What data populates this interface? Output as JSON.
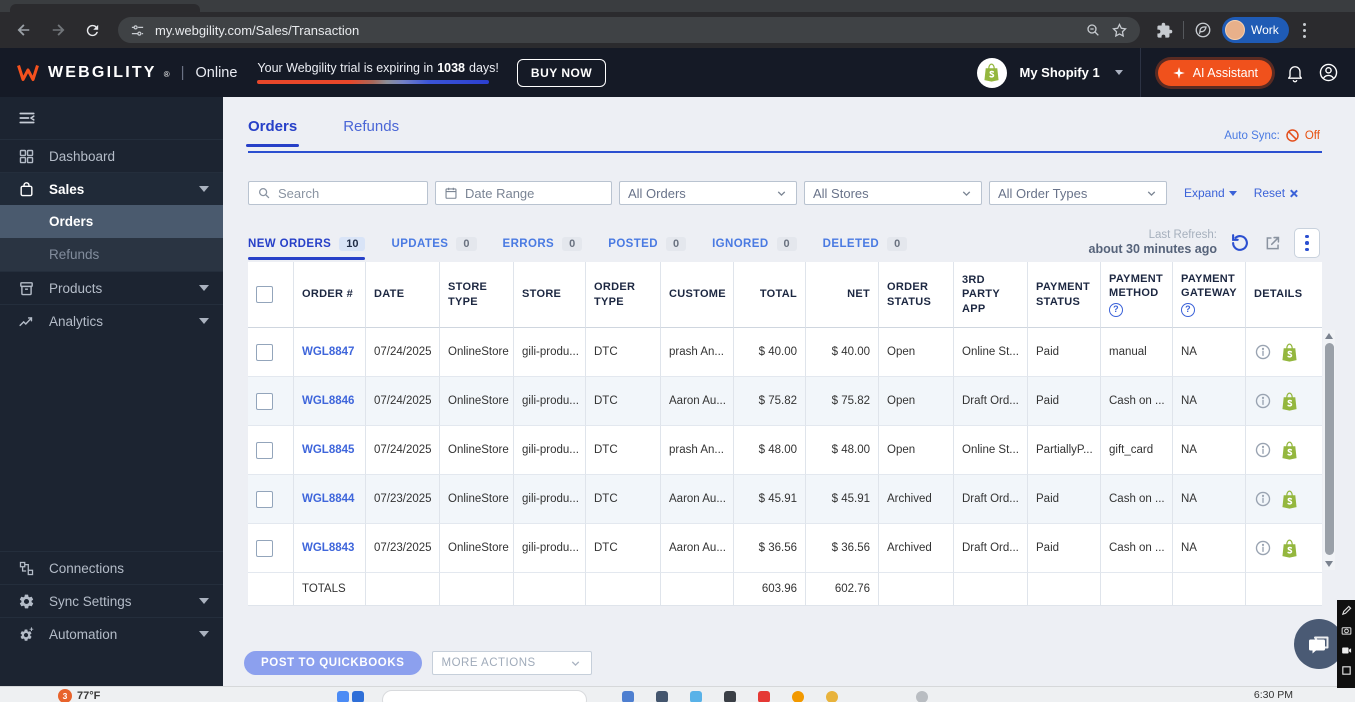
{
  "browser": {
    "url": "my.webgility.com/Sales/Transaction",
    "profile": "Work"
  },
  "header": {
    "brand": "WEBGILITY",
    "reg": "®",
    "sep": "|",
    "mode": "Online",
    "trial_prefix": "Your Webgility trial is expiring in",
    "trial_days": "1038",
    "trial_suffix": "days!",
    "buy_now": "BUY NOW",
    "store": "My Shopify 1",
    "ai": "AI Assistant"
  },
  "sidebar": {
    "dashboard": "Dashboard",
    "sales": "Sales",
    "orders": "Orders",
    "refunds": "Refunds",
    "products": "Products",
    "analytics": "Analytics",
    "connections": "Connections",
    "sync_settings": "Sync Settings",
    "automation": "Automation"
  },
  "tabs": {
    "orders": "Orders",
    "refunds": "Refunds"
  },
  "auto_sync": {
    "label": "Auto Sync:",
    "state": "Off"
  },
  "filters": {
    "search": "Search",
    "date_range": "Date Range",
    "all_orders": "All Orders",
    "all_stores": "All Stores",
    "all_order_types": "All Order Types",
    "expand": "Expand",
    "reset": "Reset"
  },
  "status_tabs": [
    {
      "label": "NEW ORDERS",
      "count": "10"
    },
    {
      "label": "UPDATES",
      "count": "0"
    },
    {
      "label": "ERRORS",
      "count": "0"
    },
    {
      "label": "POSTED",
      "count": "0"
    },
    {
      "label": "IGNORED",
      "count": "0"
    },
    {
      "label": "DELETED",
      "count": "0"
    }
  ],
  "refresh": {
    "label": "Last Refresh:",
    "value": "about 30 minutes ago"
  },
  "table": {
    "columns": [
      "ORDER #",
      "DATE",
      "STORE TYPE",
      "STORE",
      "ORDER TYPE",
      "CUSTOME",
      "TOTAL",
      "NET",
      "ORDER STATUS",
      "3RD PARTY APP",
      "PAYMENT STATUS",
      "PAYMENT METHOD",
      "PAYMENT GATEWAY",
      "DETAILS"
    ],
    "rows": [
      {
        "order_number": "WGL8847",
        "date": "07/24/2025",
        "store_type": "OnlineStore",
        "store": "gili-produ...",
        "order_type": "DTC",
        "customer": "prash An...",
        "total": "$ 40.00",
        "net": "$ 40.00",
        "order_status": "Open",
        "third_party_app": "Online St...",
        "payment_status": "Paid",
        "payment_method": "manual",
        "payment_gateway": "NA"
      },
      {
        "order_number": "WGL8846",
        "date": "07/24/2025",
        "store_type": "OnlineStore",
        "store": "gili-produ...",
        "order_type": "DTC",
        "customer": "Aaron Au...",
        "total": "$ 75.82",
        "net": "$ 75.82",
        "order_status": "Open",
        "third_party_app": "Draft Ord...",
        "payment_status": "Paid",
        "payment_method": "Cash on ...",
        "payment_gateway": "NA"
      },
      {
        "order_number": "WGL8845",
        "date": "07/24/2025",
        "store_type": "OnlineStore",
        "store": "gili-produ...",
        "order_type": "DTC",
        "customer": "prash An...",
        "total": "$ 48.00",
        "net": "$ 48.00",
        "order_status": "Open",
        "third_party_app": "Online St...",
        "payment_status": "PartiallyP...",
        "payment_method": "gift_card",
        "payment_gateway": "NA"
      },
      {
        "order_number": "WGL8844",
        "date": "07/23/2025",
        "store_type": "OnlineStore",
        "store": "gili-produ...",
        "order_type": "DTC",
        "customer": "Aaron Au...",
        "total": "$ 45.91",
        "net": "$ 45.91",
        "order_status": "Archived",
        "third_party_app": "Draft Ord...",
        "payment_status": "Paid",
        "payment_method": "Cash on ...",
        "payment_gateway": "NA"
      },
      {
        "order_number": "WGL8843",
        "date": "07/23/2025",
        "store_type": "OnlineStore",
        "store": "gili-produ...",
        "order_type": "DTC",
        "customer": "Aaron Au...",
        "total": "$ 36.56",
        "net": "$ 36.56",
        "order_status": "Archived",
        "third_party_app": "Draft Ord...",
        "payment_status": "Paid",
        "payment_method": "Cash on ...",
        "payment_gateway": "NA"
      }
    ],
    "totals": {
      "label": "TOTALS",
      "total": "603.96",
      "net": "602.76"
    }
  },
  "footer": {
    "post": "POST TO QUICKBOOKS",
    "more": "MORE ACTIONS"
  },
  "taskbar": {
    "badge": "3",
    "temp": "77°F",
    "time": "6:30 PM"
  },
  "glyphs": {
    "question": "?"
  }
}
